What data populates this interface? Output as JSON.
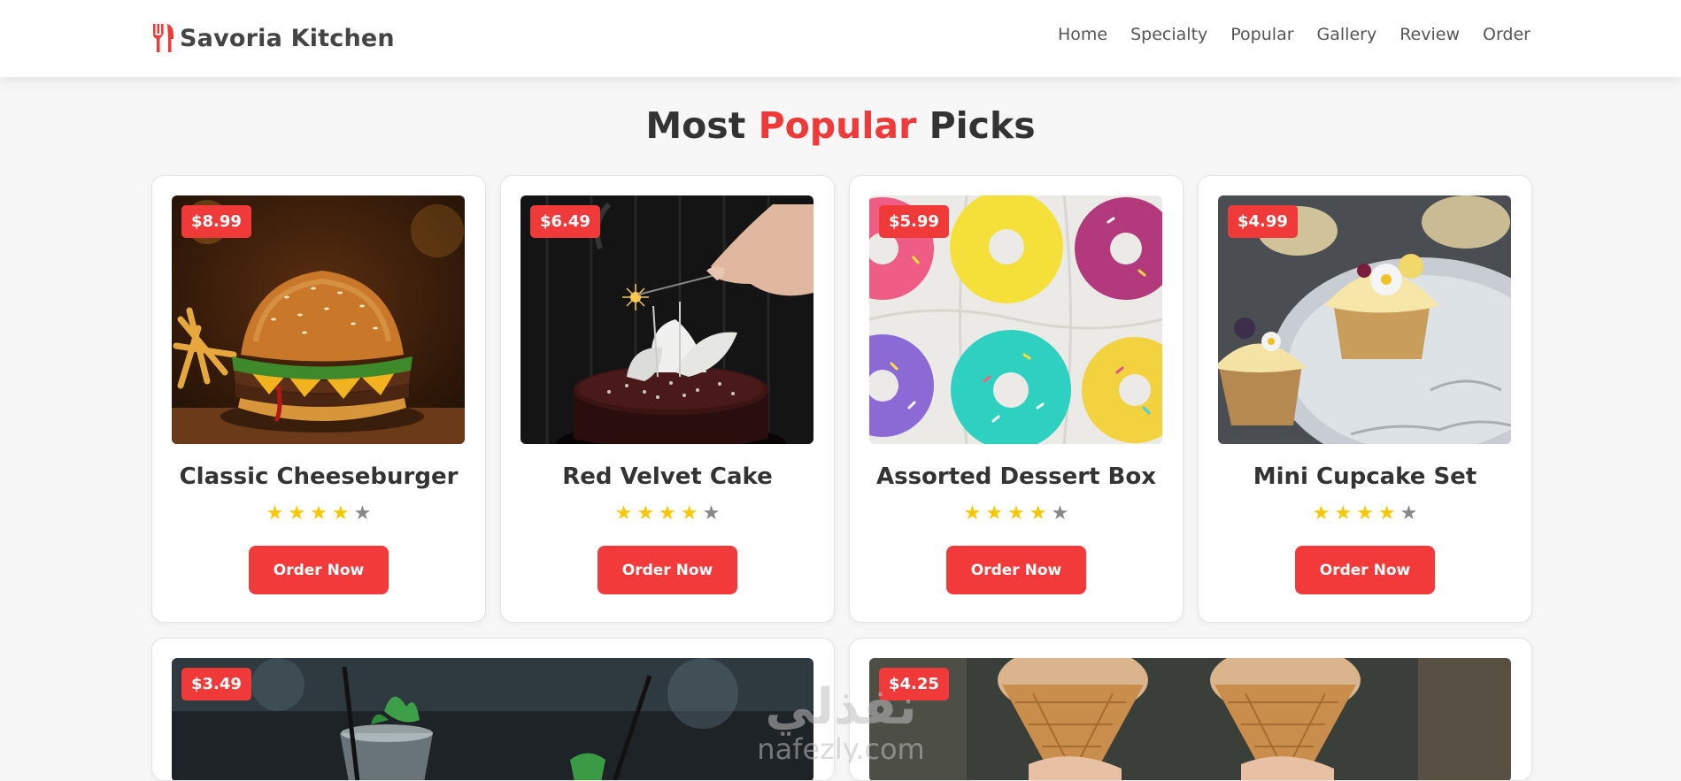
{
  "brand": {
    "name": "Savoria Kitchen",
    "icon": "utensils-icon",
    "accent": "#f03a3a"
  },
  "nav": [
    "Home",
    "Specialty",
    "Popular",
    "Gallery",
    "Review",
    "Order"
  ],
  "section": {
    "title_before": "Most",
    "title_accent": "Popular",
    "title_after": "Picks"
  },
  "colors": {
    "accent": "#f03a3a",
    "star_filled": "#f7c800",
    "star_empty": "#888888"
  },
  "items": [
    {
      "name": "Classic Cheeseburger",
      "price": "$8.99",
      "rating": 4,
      "max_rating": 5,
      "order_label": "Order Now"
    },
    {
      "name": "Red Velvet Cake",
      "price": "$6.49",
      "rating": 4,
      "max_rating": 5,
      "order_label": "Order Now"
    },
    {
      "name": "Assorted Dessert Box",
      "price": "$5.99",
      "rating": 4,
      "max_rating": 5,
      "order_label": "Order Now"
    },
    {
      "name": "Mini Cupcake Set",
      "price": "$4.99",
      "rating": 4,
      "max_rating": 5,
      "order_label": "Order Now"
    },
    {
      "price": "$3.49"
    },
    {
      "price": "$4.25"
    }
  ],
  "watermark": {
    "arabic": "نفذلي",
    "latin": "nafezly.com"
  }
}
